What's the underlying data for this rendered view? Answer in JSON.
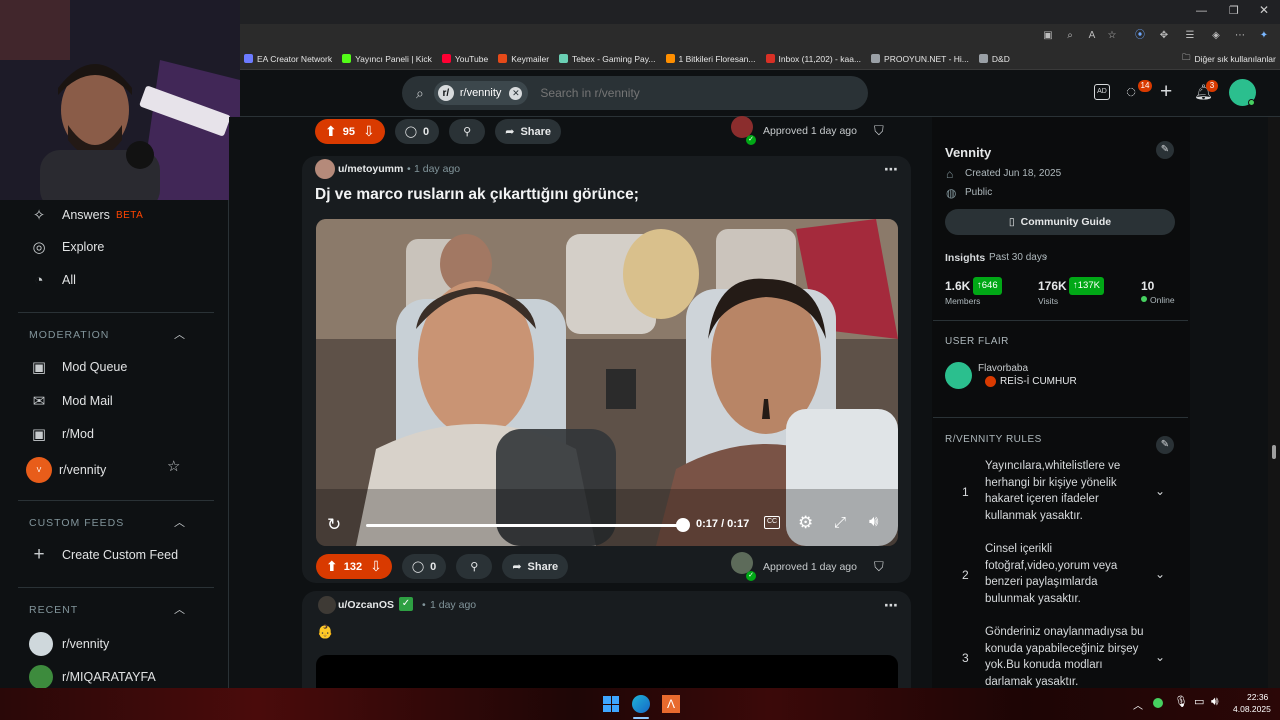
{
  "bookmarks": [
    {
      "label": "EA Creator Network",
      "color": "#6c7bff"
    },
    {
      "label": "Yayıncı Paneli | Kick",
      "color": "#53fc18"
    },
    {
      "label": "YouTube",
      "color": "#ff0033"
    },
    {
      "label": "Keymailer",
      "color": "#e64a19"
    },
    {
      "label": "Tebex - Gaming Pay...",
      "color": "#6bd0b4"
    },
    {
      "label": "1 Bitkileri Floresan...",
      "color": "#ff8f00"
    },
    {
      "label": "Inbox (11,202) - kaa...",
      "color": "#d93025"
    },
    {
      "label": "PROOYUN.NET - Hi...",
      "color": "#9aa0a6"
    },
    {
      "label": "D&D",
      "color": "#9aa0a6"
    }
  ],
  "other_bookmarks": "Diğer sık kullanılanlar",
  "search": {
    "chip": "r/vennity",
    "placeholder": "Search in r/vennity"
  },
  "header_badges": {
    "chat": "14",
    "notifications": "3"
  },
  "sidebar": {
    "items_top": [
      {
        "label": "Answers",
        "badge": "BETA",
        "icon": "answers-icon"
      },
      {
        "label": "Explore",
        "icon": "explore-icon"
      },
      {
        "label": "All",
        "icon": "all-icon"
      }
    ],
    "moderation_heading": "MODERATION",
    "moderation_items": [
      {
        "label": "Mod Queue",
        "icon": "mod-queue-icon"
      },
      {
        "label": "Mod Mail",
        "icon": "mail-icon"
      },
      {
        "label": "r/Mod",
        "icon": "mod-icon"
      },
      {
        "label": "r/vennity",
        "icon": "community-icon"
      }
    ],
    "custom_feeds_heading": "CUSTOM FEEDS",
    "create_custom_feed": "Create Custom Feed",
    "recent_heading": "RECENT",
    "recent_items": [
      {
        "label": "r/vennity"
      },
      {
        "label": "r/MIQARATAYFA"
      }
    ]
  },
  "feed": {
    "prev_post": {
      "votes": "95",
      "comments": "0",
      "share": "Share",
      "approved": "Approved 1 day ago"
    },
    "post": {
      "author": "u/metoyumm",
      "time": "1 day ago",
      "title": "Dj ve marco rusların ak çıkarttığını görünce;",
      "video_time": "0:17 / 0:17",
      "video_progress": 1.0,
      "votes": "132",
      "comments": "0",
      "share": "Share",
      "approved": "Approved 1 day ago"
    },
    "next_post": {
      "author": "u/OzcanOS",
      "time": "1 day ago",
      "emoji": "👶"
    }
  },
  "community": {
    "name": "Vennity",
    "created": "Created Jun 18, 2025",
    "visibility": "Public",
    "guide_button": "Community Guide",
    "insights_label": "Insights",
    "insights_period": "Past 30 days",
    "members_value": "1.6K",
    "members_delta": "646",
    "members_label": "Members",
    "visits_value": "176K",
    "visits_delta": "137K",
    "visits_label": "Visits",
    "online_value": "10",
    "online_label": "Online",
    "user_flair_heading": "USER FLAIR",
    "flair_user": "Flavorbaba",
    "flair_text": "REİS-İ CUMHUR",
    "rules_heading": "R/VENNITY RULES",
    "rules": [
      {
        "num": "1",
        "text": "Yayıncılara,whitelistlere ve herhangi bir kişiye yönelik hakaret içeren ifadeler kullanmak yasaktır."
      },
      {
        "num": "2",
        "text": "Cinsel içerikli fotoğraf,video,yorum veya benzeri paylaşımlarda bulunmak yasaktır."
      },
      {
        "num": "3",
        "text": "Gönderiniz onaylanmadıysa bu konuda yapabileceğiniz birşey yok.Bu konuda modları darlamak yasaktır."
      }
    ]
  },
  "taskbar": {
    "time": "22:36",
    "date": "4.08.2025"
  },
  "colors": {
    "upvote": "#d93a00",
    "online": "#46d160",
    "accent_green": "#01a816"
  }
}
